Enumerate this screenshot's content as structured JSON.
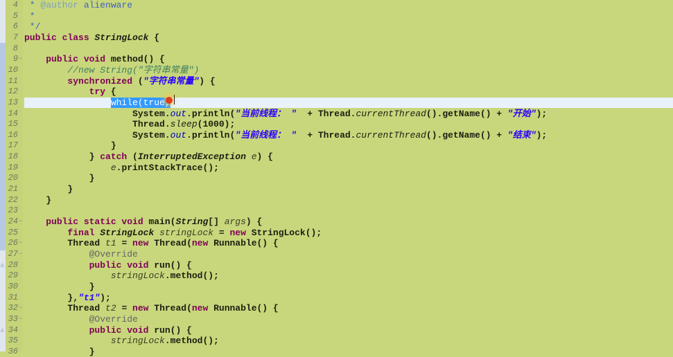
{
  "editor": {
    "current_line": 13,
    "selected_text": "while(true,",
    "lines": [
      {
        "n": 4,
        "t": [
          [
            " * ",
            "doc"
          ],
          [
            "@author",
            "tag"
          ],
          [
            " alienware",
            "doc"
          ]
        ]
      },
      {
        "n": 5,
        "t": [
          [
            " *",
            "doc"
          ]
        ]
      },
      {
        "n": 6,
        "t": [
          [
            " */",
            "doc"
          ]
        ]
      },
      {
        "n": 7,
        "t": [
          [
            "public class ",
            "kw"
          ],
          [
            "StringLock",
            "ty"
          ],
          [
            " {",
            ""
          ]
        ]
      },
      {
        "n": 8,
        "t": []
      },
      {
        "n": 9,
        "fold": true,
        "t": [
          [
            "    ",
            ""
          ],
          [
            "public void ",
            "kw"
          ],
          [
            "method() {",
            ""
          ]
        ]
      },
      {
        "n": 10,
        "t": [
          [
            "        ",
            ""
          ],
          [
            "//new String(\"字符串常量\")",
            "cm"
          ]
        ]
      },
      {
        "n": 11,
        "t": [
          [
            "        ",
            ""
          ],
          [
            "synchronized",
            "kw"
          ],
          [
            " (",
            ""
          ],
          [
            "\"字符串常量\"",
            "str"
          ],
          [
            ") {",
            ""
          ]
        ]
      },
      {
        "n": 12,
        "t": [
          [
            "            ",
            ""
          ],
          [
            "try",
            "kw"
          ],
          [
            " {",
            ""
          ]
        ]
      },
      {
        "n": 13,
        "current": true,
        "t": [
          [
            "                ",
            ""
          ],
          [
            "while(true,",
            "sel"
          ]
        ]
      },
      {
        "n": 14,
        "t": [
          [
            "                    System.",
            ""
          ],
          [
            "out",
            "fld"
          ],
          [
            ".println(",
            ""
          ],
          [
            "\"当前线程： \"",
            "str"
          ],
          [
            "  + Thread.",
            ""
          ],
          [
            "currentThread",
            "sm"
          ],
          [
            "().getName() + ",
            ""
          ],
          [
            "\"开始\"",
            "str"
          ],
          [
            ");",
            ""
          ]
        ]
      },
      {
        "n": 15,
        "t": [
          [
            "                    Thread.",
            ""
          ],
          [
            "sleep",
            "sm"
          ],
          [
            "(1000);",
            ""
          ]
        ]
      },
      {
        "n": 16,
        "t": [
          [
            "                    System.",
            ""
          ],
          [
            "out",
            "fld"
          ],
          [
            ".println(",
            ""
          ],
          [
            "\"当前线程： \"",
            "str"
          ],
          [
            "  + Thread.",
            ""
          ],
          [
            "currentThread",
            "sm"
          ],
          [
            "().getName() + ",
            ""
          ],
          [
            "\"结束\"",
            "str"
          ],
          [
            ");",
            ""
          ]
        ]
      },
      {
        "n": 17,
        "t": [
          [
            "                }",
            ""
          ]
        ]
      },
      {
        "n": 18,
        "t": [
          [
            "            } ",
            ""
          ],
          [
            "catch",
            "kw"
          ],
          [
            " (",
            ""
          ],
          [
            "InterruptedException",
            "ty"
          ],
          [
            " ",
            ""
          ],
          [
            "e",
            "var"
          ],
          [
            ") {",
            ""
          ]
        ]
      },
      {
        "n": 19,
        "t": [
          [
            "                ",
            ""
          ],
          [
            "e",
            "var"
          ],
          [
            ".printStackTrace();",
            ""
          ]
        ]
      },
      {
        "n": 20,
        "t": [
          [
            "            }",
            ""
          ]
        ]
      },
      {
        "n": 21,
        "t": [
          [
            "        }",
            ""
          ]
        ]
      },
      {
        "n": 22,
        "t": [
          [
            "    }",
            ""
          ]
        ]
      },
      {
        "n": 23,
        "t": []
      },
      {
        "n": 24,
        "fold": true,
        "t": [
          [
            "    ",
            ""
          ],
          [
            "public static void ",
            "kw"
          ],
          [
            "main(",
            ""
          ],
          [
            "String",
            "ty"
          ],
          [
            "[] ",
            ""
          ],
          [
            "args",
            "var"
          ],
          [
            ") {",
            ""
          ]
        ]
      },
      {
        "n": 25,
        "t": [
          [
            "        ",
            ""
          ],
          [
            "final ",
            "kw"
          ],
          [
            "StringLock ",
            "ty"
          ],
          [
            "stringLock",
            "var"
          ],
          [
            " = ",
            ""
          ],
          [
            "new ",
            "kw"
          ],
          [
            "StringLock();",
            ""
          ]
        ]
      },
      {
        "n": 26,
        "fold": true,
        "t": [
          [
            "        Thread ",
            ""
          ],
          [
            "t1",
            "var"
          ],
          [
            " = ",
            ""
          ],
          [
            "new ",
            "kw"
          ],
          [
            "Thread(",
            ""
          ],
          [
            "new ",
            "kw"
          ],
          [
            "Runnable() {",
            ""
          ]
        ]
      },
      {
        "n": 27,
        "fold": true,
        "t": [
          [
            "            ",
            ""
          ],
          [
            "@Override",
            "ann"
          ]
        ]
      },
      {
        "n": 28,
        "override": true,
        "t": [
          [
            "            ",
            ""
          ],
          [
            "public void ",
            "kw"
          ],
          [
            "run() {",
            ""
          ]
        ]
      },
      {
        "n": 29,
        "t": [
          [
            "                ",
            ""
          ],
          [
            "stringLock",
            "var"
          ],
          [
            ".method();",
            ""
          ]
        ]
      },
      {
        "n": 30,
        "t": [
          [
            "            }",
            ""
          ]
        ]
      },
      {
        "n": 31,
        "t": [
          [
            "        },",
            ""
          ],
          [
            "\"t1\"",
            "str"
          ],
          [
            ");",
            ""
          ]
        ]
      },
      {
        "n": 32,
        "fold": true,
        "t": [
          [
            "        Thread ",
            ""
          ],
          [
            "t2",
            "var"
          ],
          [
            " = ",
            ""
          ],
          [
            "new ",
            "kw"
          ],
          [
            "Thread(",
            ""
          ],
          [
            "new ",
            "kw"
          ],
          [
            "Runnable() {",
            ""
          ]
        ]
      },
      {
        "n": 33,
        "fold": true,
        "t": [
          [
            "            ",
            ""
          ],
          [
            "@Override",
            "ann"
          ]
        ]
      },
      {
        "n": 34,
        "override": true,
        "t": [
          [
            "            ",
            ""
          ],
          [
            "public void ",
            "kw"
          ],
          [
            "run() {",
            ""
          ]
        ]
      },
      {
        "n": 35,
        "t": [
          [
            "                ",
            ""
          ],
          [
            "stringLock",
            "var"
          ],
          [
            ".method();",
            ""
          ]
        ]
      },
      {
        "n": 36,
        "t": [
          [
            "            }",
            ""
          ]
        ]
      }
    ]
  },
  "colors": {
    "background": "#c8d77c",
    "keyword": "#7f0055",
    "string": "#2a00ff",
    "comment": "#3f7f5f",
    "selection": "#3399ff"
  }
}
